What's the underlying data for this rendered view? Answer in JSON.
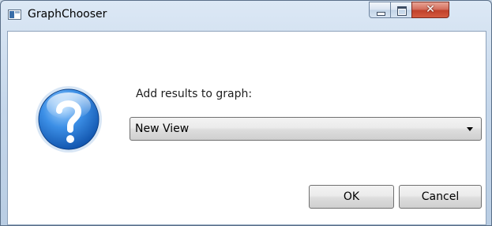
{
  "window": {
    "title": "GraphChooser",
    "controls": {
      "minimize": "minimize",
      "maximize": "maximize",
      "close": "close"
    }
  },
  "dialog": {
    "icon": "question-icon",
    "prompt": "Add results to graph:",
    "graph_select": {
      "selected": "New View",
      "options": [
        "New View"
      ]
    },
    "buttons": {
      "ok": "OK",
      "cancel": "Cancel"
    }
  },
  "colors": {
    "titlebar": "#c9d7e6",
    "close_button": "#c1412c",
    "question_icon": "#1f6fd1",
    "client_background": "#ffffff"
  }
}
